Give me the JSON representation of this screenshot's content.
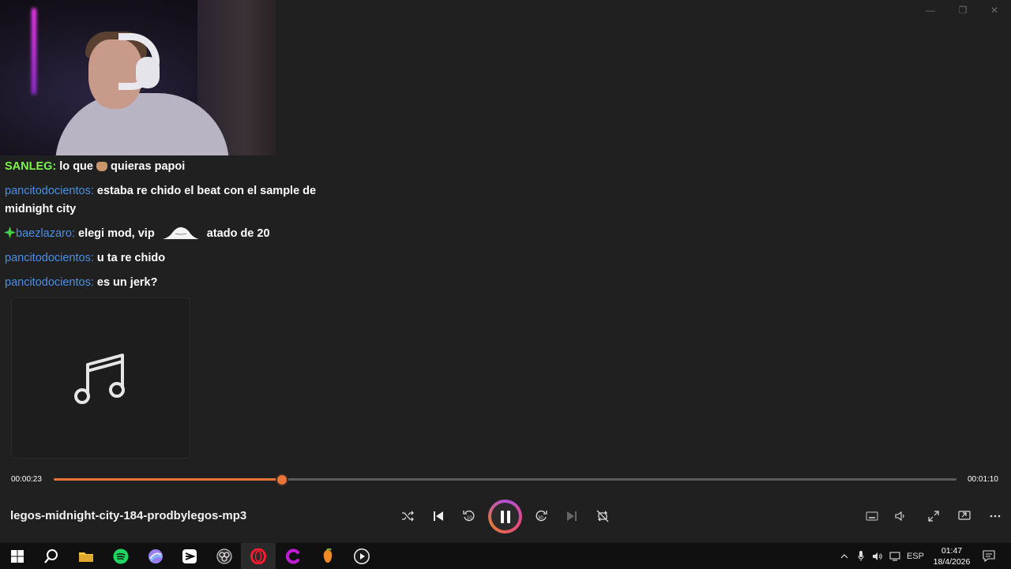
{
  "chat": [
    {
      "badge": "",
      "user": "SANLEG:",
      "message_before": "lo que",
      "message_after": "quieras papoi"
    },
    {
      "user": "pancitodocientos:",
      "message": "estaba re chido el beat con el sample de",
      "message_cont": "midnight city"
    },
    {
      "user": "baezlazaro:",
      "message_before": "elegi mod, vip",
      "message_after": "atado de 20"
    },
    {
      "user": "pancitodocientos:",
      "message": "u ta re chido"
    },
    {
      "user": "pancitodocientos:",
      "message": "es un jerk?"
    }
  ],
  "player": {
    "elapsed": "00:00:23",
    "duration": "00:01:10",
    "progress_fraction": 0.2526,
    "track_title": "legos-midnight-city-184-prodbylegos-mp3",
    "accent": "#e8743b"
  },
  "controls": [
    "shuffle-icon",
    "previous-icon",
    "rewind-10-icon",
    "pause-icon",
    "forward-30-icon",
    "next-icon",
    "repeat-off-icon"
  ],
  "right_controls": [
    "mini-player-icon",
    "volume-icon",
    "fullscreen-icon",
    "cast-icon",
    "more-icon"
  ],
  "taskbar": {
    "apps": [
      "windows-start-icon",
      "search-icon",
      "file-explorer-icon",
      "spotify-icon",
      "browser-icon",
      "capcut-icon",
      "obs-icon",
      "opera-icon",
      "canva-icon",
      "fl-studio-icon",
      "media-player-icon"
    ],
    "language": "ESP",
    "time": "01:47",
    "date": "18/4/2026"
  }
}
